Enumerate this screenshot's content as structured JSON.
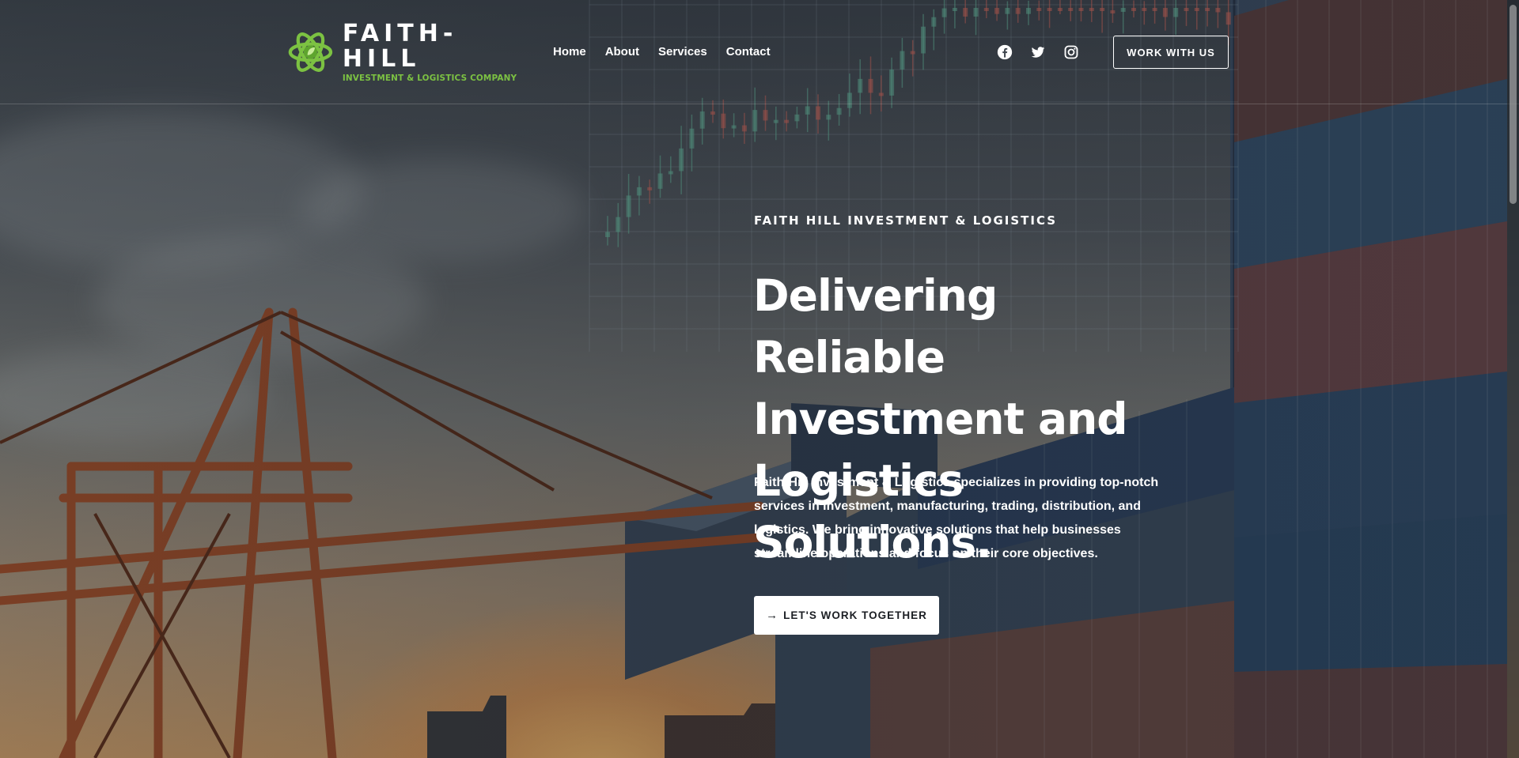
{
  "brand": {
    "name": "FAITH-HILL",
    "tagline": "INVESTMENT & LOGISTICS COMPANY",
    "accent_color": "#7cc242",
    "logo_icon": "atom-leaf-icon"
  },
  "nav": {
    "items": [
      {
        "label": "Home"
      },
      {
        "label": "About"
      },
      {
        "label": "Services"
      },
      {
        "label": "Contact"
      }
    ]
  },
  "socials": [
    {
      "icon": "facebook-icon"
    },
    {
      "icon": "twitter-icon"
    },
    {
      "icon": "instagram-icon"
    }
  ],
  "header_cta": {
    "label": "WORK WITH US"
  },
  "hero": {
    "kicker": "FAITH HILL INVESTMENT & LOGISTICS",
    "headline": "Delivering Reliable Investment and Logistics Solutions.",
    "description": "Faith-Hill Investment & Logistics specializes in providing top-notch services in investment, manufacturing, trading, distribution, and logistics. We bring innovative solutions that help businesses streamline operations and focus on their core objectives.",
    "cta_label": "LET'S WORK TOGETHER",
    "cta_icon": "arrow-right-icon"
  },
  "colors": {
    "text": "#ffffff",
    "button_bg": "#ffffff",
    "button_text": "#1c1f24"
  }
}
